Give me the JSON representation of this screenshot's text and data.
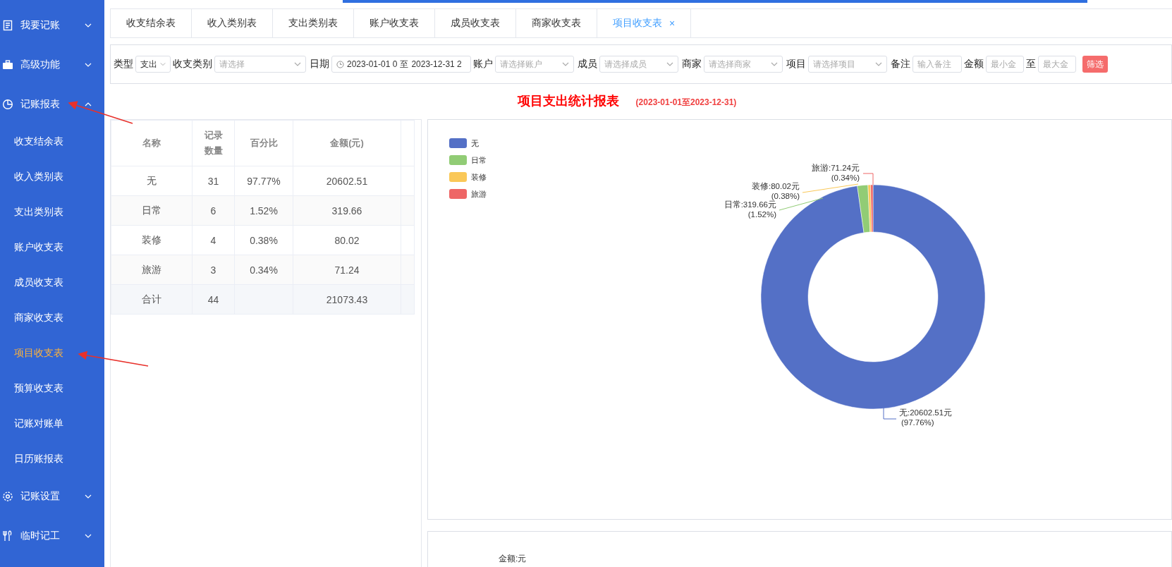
{
  "sidebar": {
    "items": [
      {
        "label": "我要记账",
        "expanded": false
      },
      {
        "label": "高级功能",
        "expanded": false
      },
      {
        "label": "记账报表",
        "expanded": true,
        "children": [
          {
            "label": "收支结余表",
            "selected": false
          },
          {
            "label": "收入类别表",
            "selected": false
          },
          {
            "label": "支出类别表",
            "selected": false
          },
          {
            "label": "账户收支表",
            "selected": false
          },
          {
            "label": "成员收支表",
            "selected": false
          },
          {
            "label": "商家收支表",
            "selected": false
          },
          {
            "label": "项目收支表",
            "selected": true
          },
          {
            "label": "预算收支表",
            "selected": false
          },
          {
            "label": "记账对账单",
            "selected": false
          },
          {
            "label": "日历账报表",
            "selected": false
          }
        ]
      },
      {
        "label": "记账设置",
        "expanded": false
      },
      {
        "label": "临时记工",
        "expanded": false
      }
    ]
  },
  "tabs": [
    {
      "label": "收支结余表",
      "selected": false
    },
    {
      "label": "收入类别表",
      "selected": false
    },
    {
      "label": "支出类别表",
      "selected": false
    },
    {
      "label": "账户收支表",
      "selected": false
    },
    {
      "label": "成员收支表",
      "selected": false
    },
    {
      "label": "商家收支表",
      "selected": false
    },
    {
      "label": "项目收支表",
      "selected": true,
      "close": "×"
    }
  ],
  "filters": {
    "type": {
      "label": "类型",
      "value": "支出"
    },
    "category": {
      "label": "收支类别",
      "placeholder": "请选择"
    },
    "date": {
      "label": "日期",
      "start": "2023-01-01 0",
      "separator": "至",
      "end": "2023-12-31 2"
    },
    "account": {
      "label": "账户",
      "placeholder": "请选择账户"
    },
    "member": {
      "label": "成员",
      "placeholder": "请选择成员"
    },
    "merchant": {
      "label": "商家",
      "placeholder": "请选择商家"
    },
    "project": {
      "label": "项目",
      "placeholder": "请选择项目"
    },
    "note": {
      "label": "备注",
      "placeholder": "输入备注"
    },
    "amount": {
      "label": "金额",
      "min_placeholder": "最小金",
      "separator": "至",
      "max_placeholder": "最大金"
    },
    "button": "筛选"
  },
  "report": {
    "title": "项目支出统计报表",
    "period": "(2023-01-01至2023-12-31)"
  },
  "table": {
    "columns": [
      "名称",
      "记录数量",
      "百分比",
      "金额(元)"
    ],
    "rows": [
      {
        "name": "无",
        "count": "31",
        "percent": "97.77%",
        "amount": "20602.51"
      },
      {
        "name": "日常",
        "count": "6",
        "percent": "1.52%",
        "amount": "319.66"
      },
      {
        "name": "装修",
        "count": "4",
        "percent": "0.38%",
        "amount": "80.02"
      },
      {
        "name": "旅游",
        "count": "3",
        "percent": "0.34%",
        "amount": "71.24"
      }
    ],
    "total": {
      "name": "合计",
      "count": "44",
      "amount": "21073.43"
    }
  },
  "pie_panel": {
    "legend": [
      {
        "color": "#5470c6"
      },
      {
        "color": "#91cc75"
      },
      {
        "color": "#fac858"
      },
      {
        "color": "#ee6666"
      }
    ],
    "slice_labels": [
      {
        "text": "无:20602.51元",
        "percent": "(97.76%)"
      },
      {
        "text": "日常:319.66元",
        "percent": "(1.52%)"
      },
      {
        "text": "装修:80.02元",
        "percent": "(0.38%)"
      },
      {
        "text": "旅游:71.24元",
        "percent": "(0.34%)"
      }
    ],
    "chart_data": {
      "type": "donut",
      "categories": [
        "无",
        "日常",
        "装修",
        "旅游"
      ],
      "values": [
        97.76,
        1.52,
        0.38,
        0.34
      ]
    }
  },
  "bottom_panel": {
    "axis_label": "金额:元"
  }
}
